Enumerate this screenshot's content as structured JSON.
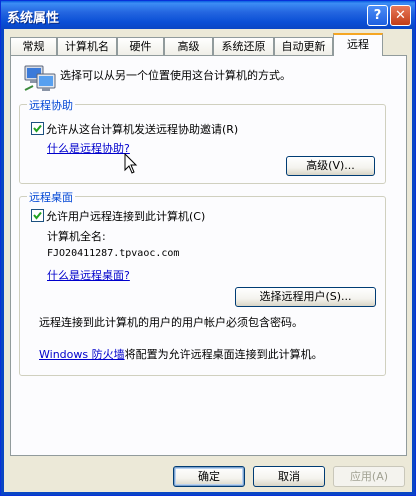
{
  "window": {
    "title": "系统属性",
    "help_glyph": "?",
    "close_glyph": "✕"
  },
  "tabs": [
    {
      "label": "常规"
    },
    {
      "label": "计算机名"
    },
    {
      "label": "硬件"
    },
    {
      "label": "高级"
    },
    {
      "label": "系统还原"
    },
    {
      "label": "自动更新"
    },
    {
      "label": "远程"
    }
  ],
  "intro_text": "选择可以从另一个位置使用这台计算机的方式。",
  "remote_assistance": {
    "title": "远程协助",
    "checkbox_label": "允许从这台计算机发送远程协助邀请(R)",
    "checked": true,
    "help_link": "什么是远程协助?",
    "advanced_button": "高级(V)..."
  },
  "remote_desktop": {
    "title": "远程桌面",
    "checkbox_label": "允许用户远程连接到此计算机(C)",
    "checked": true,
    "fullname_label": "计算机全名:",
    "computer_name": "FJO20411287.tpvaoc.com",
    "help_link": "什么是远程桌面?",
    "select_users_button": "选择远程用户(S)...",
    "password_note": "远程连接到此计算机的用户的用户帐户必须包含密码。",
    "firewall_link": "Windows 防火墙",
    "firewall_text": "将配置为允许远程桌面连接到此计算机。"
  },
  "buttons": {
    "ok": "确定",
    "cancel": "取消",
    "apply": "应用(A)"
  }
}
